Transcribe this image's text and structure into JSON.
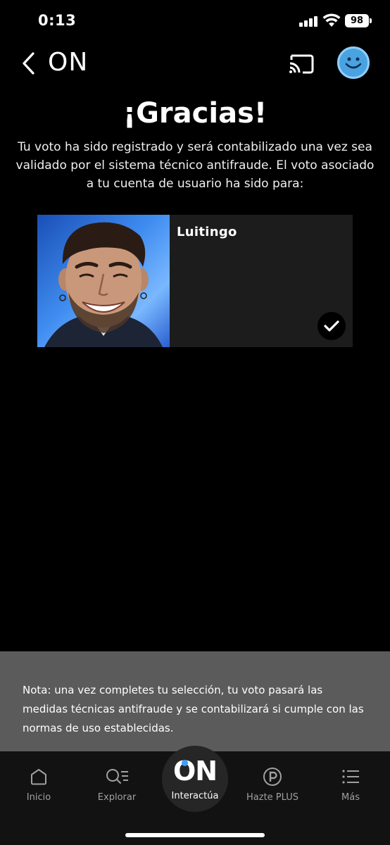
{
  "status_bar": {
    "time": "0:13",
    "battery": "98"
  },
  "header": {
    "back_icon": "chevron-left-icon",
    "logo": "ON",
    "cast_icon": "cast-icon",
    "avatar_icon": "smiley-avatar-icon"
  },
  "content": {
    "title": "¡Gracias!",
    "subtitle": "Tu voto ha sido registrado y será contabilizado una vez sea validado por el sistema técnico antifraude. El voto asociado a tu cuenta de usuario ha sido para:"
  },
  "card": {
    "name": "Luitingo",
    "check_icon": "checkmark-icon"
  },
  "note": {
    "text": "Nota: una vez completes tu selección, tu voto pasará las medidas técnicas antifraude y se contabilizará si cumple con las normas de uso establecidas."
  },
  "nav": {
    "items": [
      {
        "label": "Inicio",
        "icon": "home-icon"
      },
      {
        "label": "Explorar",
        "icon": "search-list-icon"
      },
      {
        "label": "Interactúa",
        "icon": "on-logo-icon",
        "logo": "ON"
      },
      {
        "label": "Hazte PLUS",
        "icon": "plus-p-icon"
      },
      {
        "label": "Más",
        "icon": "menu-list-icon"
      }
    ]
  },
  "colors": {
    "background": "#000000",
    "note_background": "#5b5b5b",
    "nav_background": "#121212",
    "accent_blue": "#3aa0ff",
    "avatar_blue": "#4aa3e0"
  }
}
